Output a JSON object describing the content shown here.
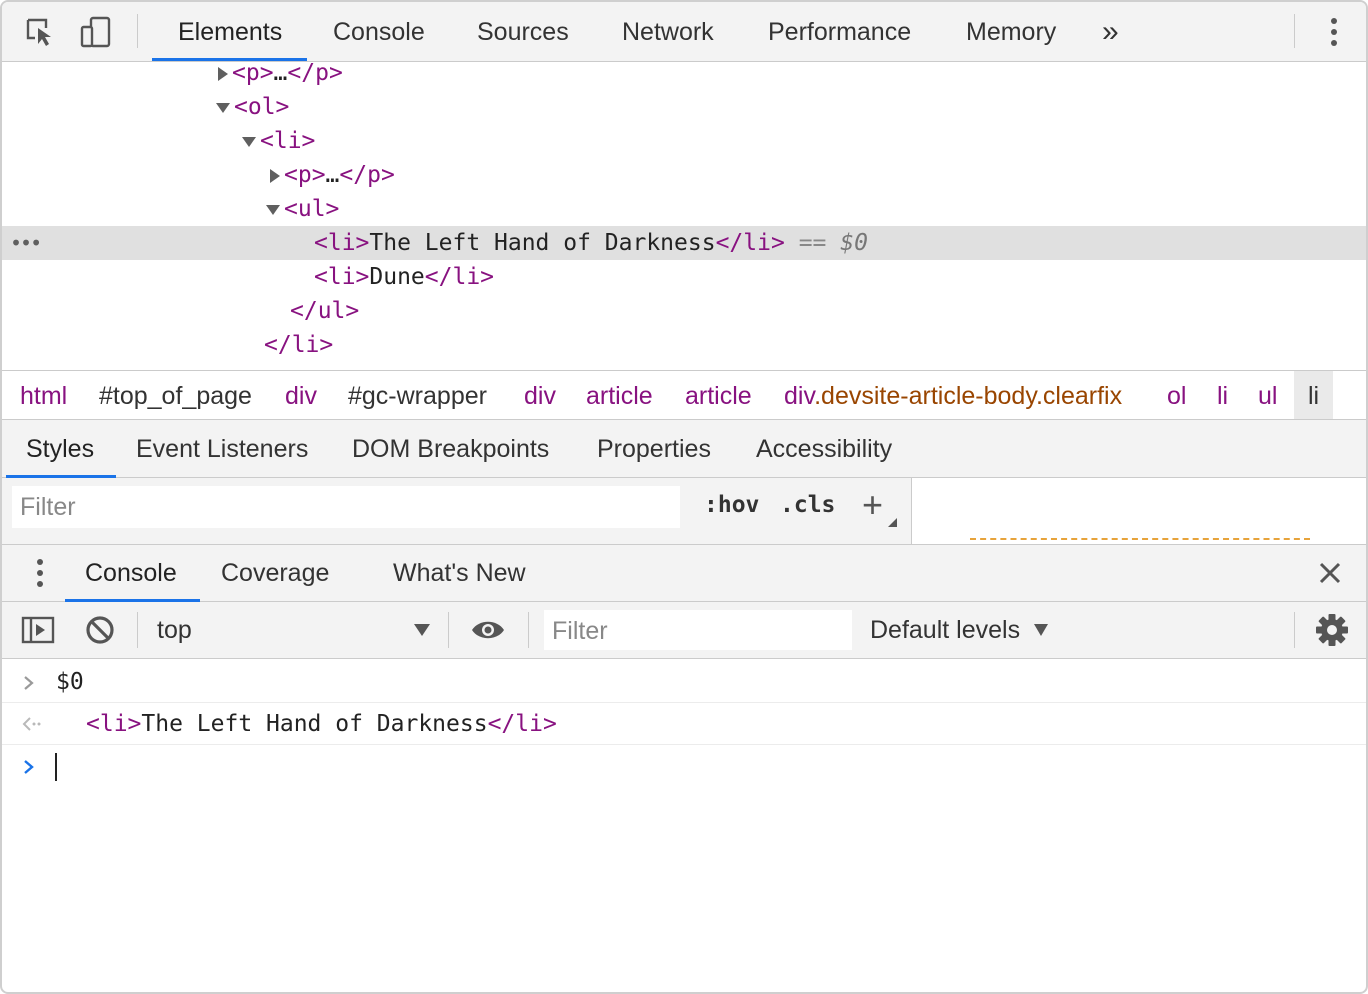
{
  "main_tabs": [
    "Elements",
    "Console",
    "Sources",
    "Network",
    "Performance",
    "Memory"
  ],
  "more_tabs_glyph": "»",
  "tree": {
    "rows": [
      {
        "open": "<p>",
        "ellipsis": "…",
        "close": "</p>"
      },
      {
        "open": "<ol>"
      },
      {
        "open": "<li>"
      },
      {
        "open": "<p>",
        "ellipsis": "…",
        "close": "</p>"
      },
      {
        "open": "<ul>"
      },
      {
        "open": "<li>",
        "text": "The Left Hand of Darkness",
        "close": "</li>",
        "eq": "==",
        "ref": "$0"
      },
      {
        "open": "<li>",
        "text": "Dune",
        "close": "</li>"
      },
      {
        "close": "</ul>"
      },
      {
        "close": "</li>"
      }
    ],
    "row_dots": "•••"
  },
  "breadcrumbs": [
    "html",
    "#top_of_page",
    "div",
    "#gc-wrapper",
    "div",
    "article",
    "article",
    "div",
    ".devsite-article-body.clearfix",
    "ol",
    "li",
    "ul",
    "li"
  ],
  "style_tabs": [
    "Styles",
    "Event Listeners",
    "DOM Breakpoints",
    "Properties",
    "Accessibility"
  ],
  "styles_filter": {
    "placeholder": "Filter",
    "hov": ":hov",
    "cls": ".cls",
    "plus": "+"
  },
  "drawer_tabs": [
    "Console",
    "Coverage",
    "What's New"
  ],
  "console_toolbar": {
    "context": "top",
    "filter_placeholder": "Filter",
    "levels": "Default levels"
  },
  "console_lines": {
    "input": "$0",
    "output_open": "<li>",
    "output_text": "The Left Hand of Darkness",
    "output_close": "</li>"
  },
  "colors": {
    "accent": "#1a73e8",
    "tag": "#881280",
    "class": "#994500",
    "selected_row": "#e0e0e0"
  }
}
